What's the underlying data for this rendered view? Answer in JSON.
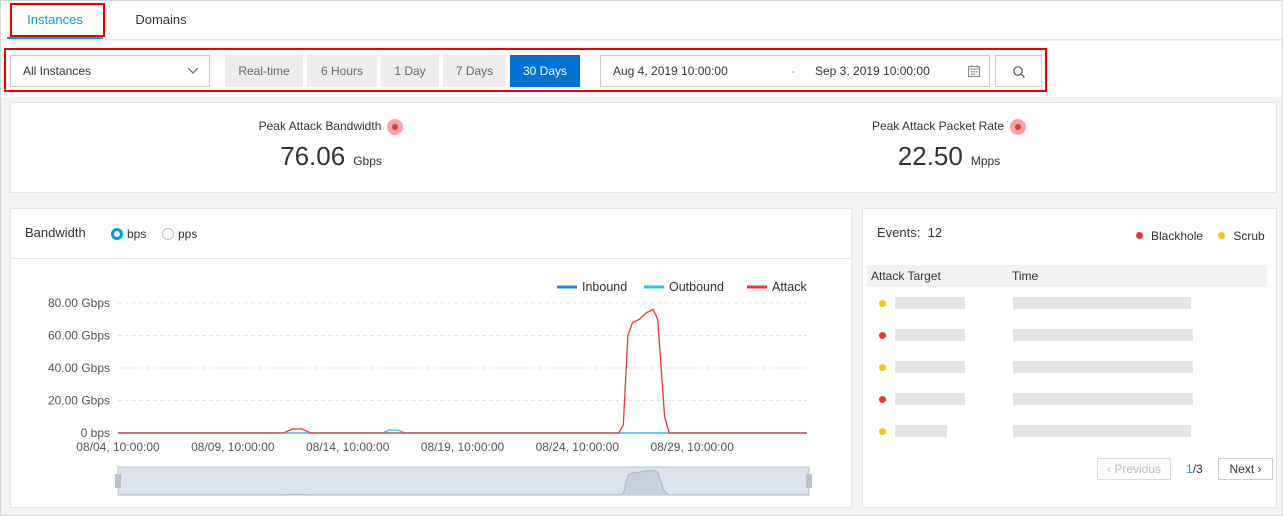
{
  "tabs": [
    {
      "label": "Instances",
      "active": true
    },
    {
      "label": "Domains",
      "active": false
    }
  ],
  "filters": {
    "instance_select": "All Instances",
    "ranges": [
      {
        "label": "Real-time",
        "active": false
      },
      {
        "label": "6 Hours",
        "active": false
      },
      {
        "label": "1 Day",
        "active": false
      },
      {
        "label": "7 Days",
        "active": false
      },
      {
        "label": "30 Days",
        "active": true
      }
    ],
    "date_start": "Aug 4, 2019 10:00:00",
    "date_sep": "-",
    "date_end": "Sep 3, 2019 10:00:00"
  },
  "stats": {
    "bandwidth": {
      "label": "Peak Attack Bandwidth",
      "value": "76.06",
      "unit": "Gbps"
    },
    "packet_rate": {
      "label": "Peak Attack Packet Rate",
      "value": "22.50",
      "unit": "Mpps"
    }
  },
  "bandwidth_panel": {
    "title": "Bandwidth",
    "radio_bps": "bps",
    "radio_pps": "pps"
  },
  "chart_data": {
    "type": "line",
    "x_ticks": [
      "08/04, 10:00:00",
      "08/09, 10:00:00",
      "08/14, 10:00:00",
      "08/19, 10:00:00",
      "08/24, 10:00:00",
      "08/29, 10:00:00"
    ],
    "y_ticks": [
      "0 bps",
      "20.00 Gbps",
      "40.00 Gbps",
      "60.00 Gbps",
      "80.00 Gbps"
    ],
    "ylim": [
      0,
      80
    ],
    "x_range_days": [
      0,
      30
    ],
    "grid": true,
    "legend_position": "top-right",
    "series": [
      {
        "name": "Inbound",
        "color": "#1e88e5",
        "points": [
          [
            0,
            0
          ],
          [
            30,
            0
          ]
        ]
      },
      {
        "name": "Outbound",
        "color": "#26c6da",
        "points": [
          [
            0,
            0
          ],
          [
            11.5,
            0
          ],
          [
            11.8,
            1.8
          ],
          [
            12.2,
            1.8
          ],
          [
            12.5,
            0
          ],
          [
            30,
            0
          ]
        ]
      },
      {
        "name": "Attack",
        "color": "#e53935",
        "points": [
          [
            0,
            0
          ],
          [
            7.2,
            0
          ],
          [
            7.6,
            2.5
          ],
          [
            8.0,
            2.5
          ],
          [
            8.4,
            0
          ],
          [
            21.8,
            0
          ],
          [
            22.0,
            5
          ],
          [
            22.2,
            60
          ],
          [
            22.4,
            68
          ],
          [
            22.7,
            70
          ],
          [
            23.0,
            74
          ],
          [
            23.3,
            76.06
          ],
          [
            23.5,
            70
          ],
          [
            23.6,
            50
          ],
          [
            23.8,
            10
          ],
          [
            24.0,
            0
          ],
          [
            30,
            0
          ]
        ]
      }
    ]
  },
  "events": {
    "title": "Events:",
    "count": "12",
    "legend": [
      {
        "label": "Blackhole",
        "color": "#e53935"
      },
      {
        "label": "Scrub",
        "color": "#f5c518"
      }
    ],
    "col_target": "Attack Target",
    "col_time": "Time",
    "rows": [
      {
        "type": "#f5c518"
      },
      {
        "type": "#e53935"
      },
      {
        "type": "#f5c518"
      },
      {
        "type": "#e53935"
      },
      {
        "type": "#f5c518"
      }
    ],
    "pager": {
      "prev": "Previous",
      "page": "1",
      "total": "/3",
      "next": "Next"
    }
  }
}
